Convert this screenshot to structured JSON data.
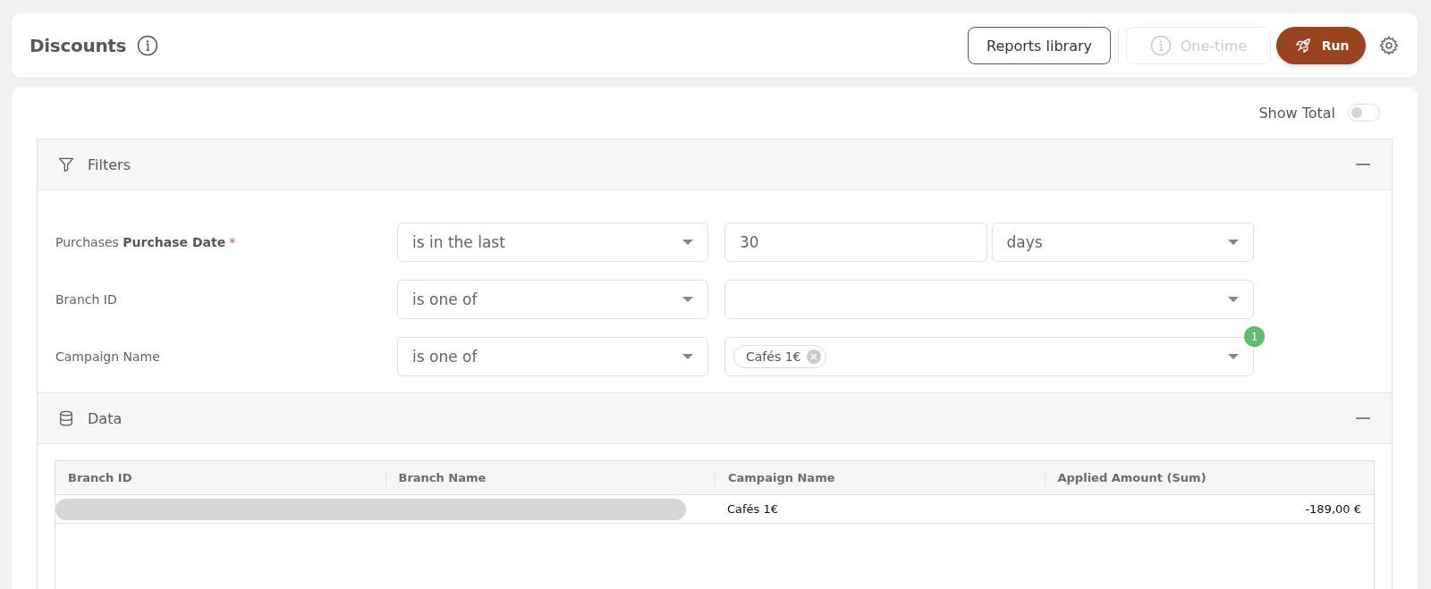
{
  "header": {
    "title": "Discounts",
    "buttons": [
      {
        "kind": "outline",
        "label": "Reports library",
        "disabled": false
      },
      {
        "kind": "schedule",
        "label": "One-time",
        "disabled": true
      },
      {
        "kind": "run",
        "label": "Run",
        "disabled": false
      }
    ]
  },
  "show_total": {
    "label": "Show Total",
    "on": false
  },
  "filters": {
    "title": "Filters",
    "expanded": true,
    "rows": [
      {
        "kind": "number_unit",
        "label": "Purchases **Purchase Date**",
        "required_mark": "*",
        "operator": "is in the last",
        "value": "30",
        "unit": "days"
      },
      {
        "kind": "multi",
        "label": "Branch ID",
        "operator": "is one of",
        "tags": []
      },
      {
        "kind": "multi",
        "label": "Campaign Name",
        "operator": "is one of",
        "tags": [
          "Cafés 1€"
        ],
        "count": "1"
      }
    ]
  },
  "data": {
    "title": "Data",
    "expanded": true,
    "table": {
      "columns": [
        "Branch ID",
        "Branch Name",
        "Campaign Name",
        "Applied Amount (Sum)"
      ],
      "rows": [
        {
          "campaign_name": "Cafés 1€",
          "applied_amount": "-189,00 €"
        }
      ]
    }
  }
}
